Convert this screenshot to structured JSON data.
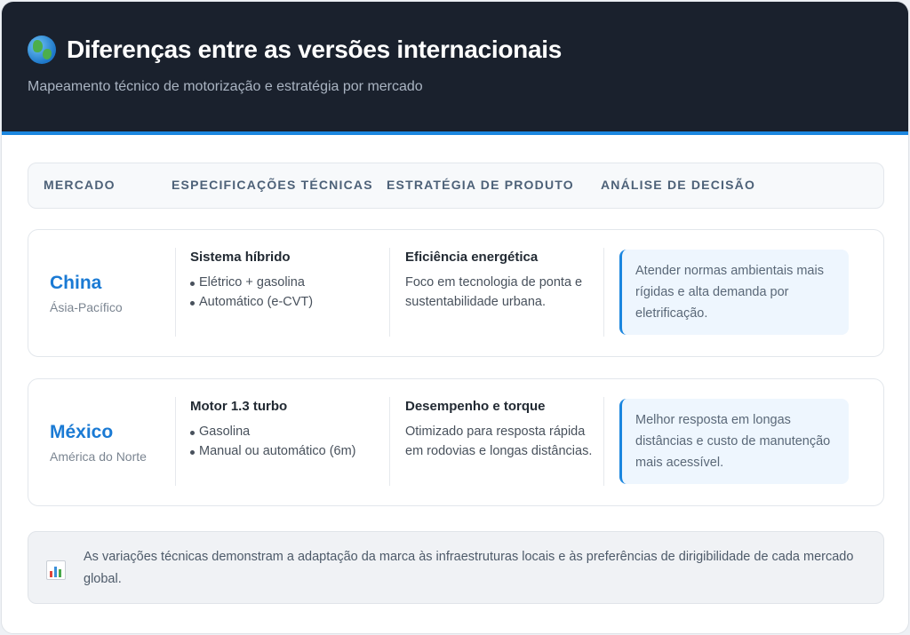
{
  "header": {
    "title": "Diferenças entre as versões internacionais",
    "subtitle": "Mapeamento técnico de motorização e estratégia por mercado",
    "icon": "globe-icon"
  },
  "columns": [
    "MERCADO",
    "ESPECIFICAÇÕES TÉCNICAS",
    "ESTRATÉGIA DE PRODUTO",
    "ANÁLISE DE DECISÃO"
  ],
  "rows": [
    {
      "market": "China",
      "region": "Ásia-Pacífico",
      "spec_title": "Sistema híbrido",
      "spec_items": [
        "Elétrico + gasolina",
        "Automático (e-CVT)"
      ],
      "strategy_title": "Eficiência energética",
      "strategy_text": "Foco em tecnologia de ponta e sustentabilidade urbana.",
      "analysis": "Atender normas ambientais mais rígidas e alta demanda por eletrificação."
    },
    {
      "market": "México",
      "region": "América do Norte",
      "spec_title": "Motor 1.3 turbo",
      "spec_items": [
        "Gasolina",
        "Manual ou automático (6m)"
      ],
      "strategy_title": "Desempenho e torque",
      "strategy_text": "Otimizado para resposta rápida em rodovias e longas distâncias.",
      "analysis": "Melhor resposta em longas distâncias e custo de manutenção mais acessível."
    }
  ],
  "footer": {
    "icon": "bar-chart-icon",
    "text": "As variações técnicas demonstram a adaptação da marca às infraestruturas locais e às preferências de dirigibilidade de cada mercado global."
  },
  "colors": {
    "header_bg": "#1a212d",
    "accent": "#1b86df",
    "market_name": "#1a7ad4"
  }
}
